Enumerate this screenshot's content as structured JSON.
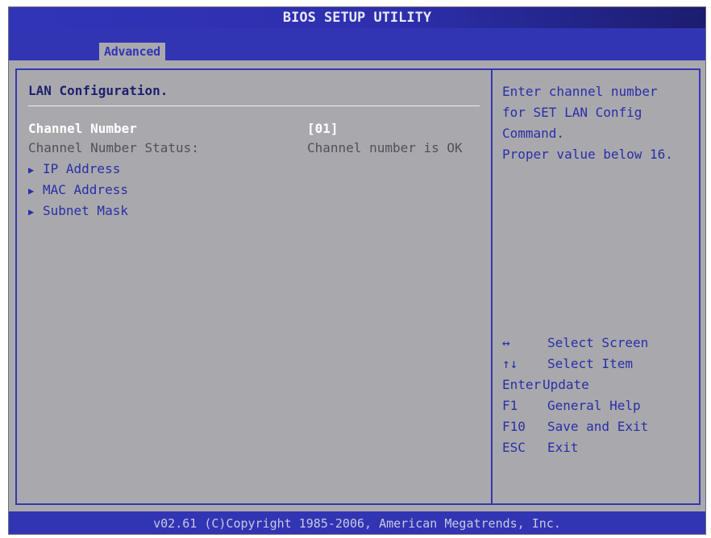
{
  "header": {
    "title": "BIOS SETUP UTILITY",
    "tabs": [
      {
        "label": "Advanced"
      }
    ]
  },
  "main": {
    "section_title": "LAN Configuration.",
    "settings": [
      {
        "label": "Channel Number",
        "value": "[01]"
      },
      {
        "label": "Channel Number Status:",
        "value": "Channel number is OK"
      }
    ],
    "submenus": [
      {
        "label": "IP Address",
        "icon": "right-triangle-icon"
      },
      {
        "label": "MAC Address",
        "icon": "right-triangle-icon"
      },
      {
        "label": "Subnet Mask",
        "icon": "right-triangle-icon"
      }
    ]
  },
  "help": {
    "lines": [
      "Enter channel number",
      "for SET LAN Config",
      "Command.",
      "Proper value below 16."
    ],
    "keys": [
      {
        "key": "↔",
        "desc": "Select Screen"
      },
      {
        "key": "↑↓",
        "desc": "Select Item"
      },
      {
        "key": "Enter",
        "desc": "Update"
      },
      {
        "key": "F1",
        "desc": "General Help"
      },
      {
        "key": "F10",
        "desc": "Save and Exit"
      },
      {
        "key": "ESC",
        "desc": "Exit"
      }
    ]
  },
  "footer": {
    "text": "v02.61 (C)Copyright 1985-2006, American Megatrends, Inc."
  },
  "colors": {
    "background": "#a9a9ad",
    "accent": "#3135b3",
    "text_blue": "#2a2ea8",
    "selected": "#ffffff"
  }
}
